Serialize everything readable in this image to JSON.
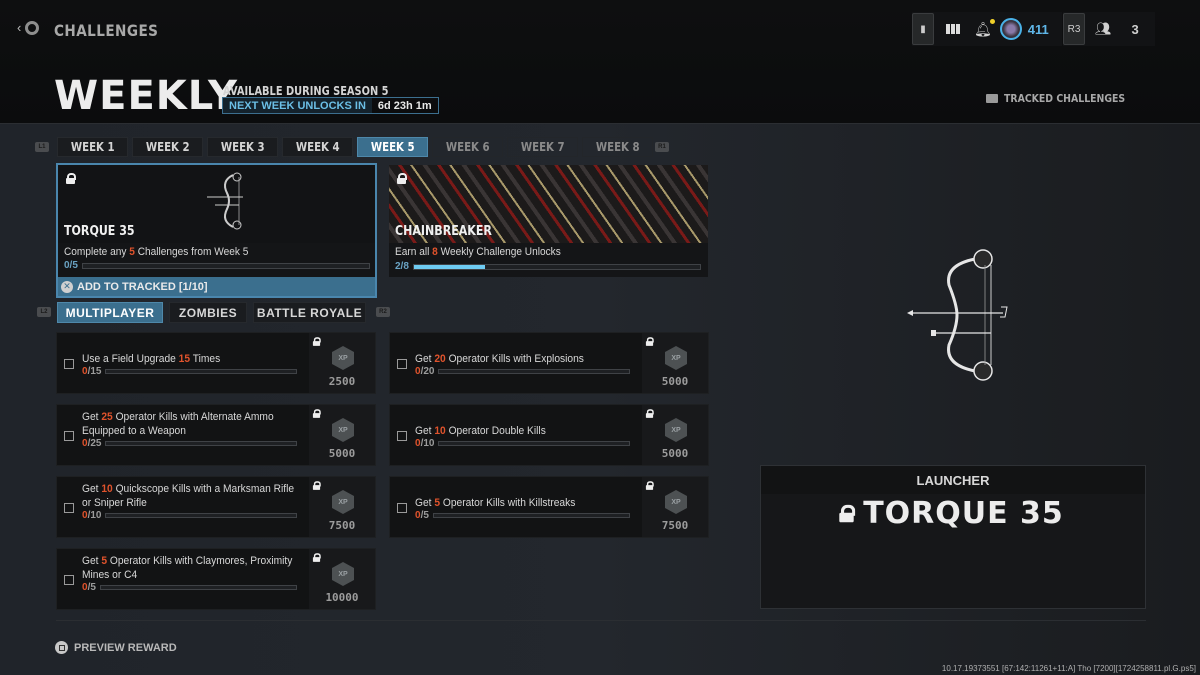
{
  "header": {
    "breadcrumb": "CHALLENGES",
    "title": "WEEKLY",
    "availability": "AVAILABLE DURING SEASON 5",
    "next_week_label": "NEXT WEEK UNLOCKS IN",
    "next_week_timer": "6d 23h 1m",
    "tracked_challenges": "TRACKED CHALLENGES"
  },
  "topbar": {
    "player_level": "411",
    "party_button": "R3",
    "party_count": "3",
    "notification_dot_color": "#f0d02a"
  },
  "bumpers": {
    "left_week": "L1",
    "right_week": "R1",
    "left_mode": "L2",
    "right_mode": "R2"
  },
  "weeks": [
    {
      "label": "WEEK 1",
      "state": "available"
    },
    {
      "label": "WEEK 2",
      "state": "available"
    },
    {
      "label": "WEEK 3",
      "state": "available"
    },
    {
      "label": "WEEK 4",
      "state": "available"
    },
    {
      "label": "WEEK 5",
      "state": "active"
    },
    {
      "label": "WEEK 6",
      "state": "locked"
    },
    {
      "label": "WEEK 7",
      "state": "locked"
    },
    {
      "label": "WEEK 8",
      "state": "locked"
    }
  ],
  "rewards": [
    {
      "name": "TORQUE 35",
      "desc_pre": "Complete any ",
      "desc_num": "5",
      "desc_post": " Challenges from Week 5",
      "progress": "0/5",
      "progress_fraction": 0.0,
      "track_label": "ADD TO TRACKED [1/10]"
    },
    {
      "name": "CHAINBREAKER",
      "desc_pre": "Earn all ",
      "desc_num": "8",
      "desc_post": " Weekly Challenge Unlocks",
      "progress": "2/8",
      "progress_fraction": 0.25
    }
  ],
  "modes": [
    {
      "label": "MULTIPLAYER",
      "active": true
    },
    {
      "label": "ZOMBIES",
      "active": false
    },
    {
      "label": "BATTLE ROYALE",
      "active": false
    }
  ],
  "challenges": [
    {
      "pre": "Use a Field Upgrade ",
      "num": "15",
      "post": " Times",
      "done": "0",
      "total": "/15",
      "xp": "2500"
    },
    {
      "pre": "Get ",
      "num": "20",
      "post": " Operator Kills with Explosions",
      "done": "0",
      "total": "/20",
      "xp": "5000"
    },
    {
      "pre": "Get ",
      "num": "25",
      "post": " Operator Kills with Alternate Ammo Equipped to a Weapon",
      "done": "0",
      "total": "/25",
      "xp": "5000"
    },
    {
      "pre": "Get ",
      "num": "10",
      "post": " Operator Double Kills",
      "done": "0",
      "total": "/10",
      "xp": "5000"
    },
    {
      "pre": "Get ",
      "num": "10",
      "post": " Quickscope Kills with a Marksman Rifle or Sniper Rifle",
      "done": "0",
      "total": "/10",
      "xp": "7500"
    },
    {
      "pre": "Get ",
      "num": "5",
      "post": " Operator Kills with Killstreaks",
      "done": "0",
      "total": "/5",
      "xp": "7500"
    },
    {
      "pre": "Get ",
      "num": "5",
      "post": " Operator Kills with Claymores, Proximity Mines or C4",
      "done": "0",
      "total": "/5",
      "xp": "10000"
    }
  ],
  "xp_badge": "XP",
  "preview_panel": {
    "category": "LAUNCHER",
    "weapon_name": "TORQUE 35"
  },
  "footer": {
    "preview_reward": "PREVIEW REWARD",
    "build_info": "10.17.19373551 [67:142:11261+11:A] Tho [7200][1724258811.pl.G.ps5]"
  },
  "colors": {
    "accent_blue": "#3b6f8e",
    "highlight_orange": "#e0532c",
    "progress_blue": "#6ecbf2"
  }
}
